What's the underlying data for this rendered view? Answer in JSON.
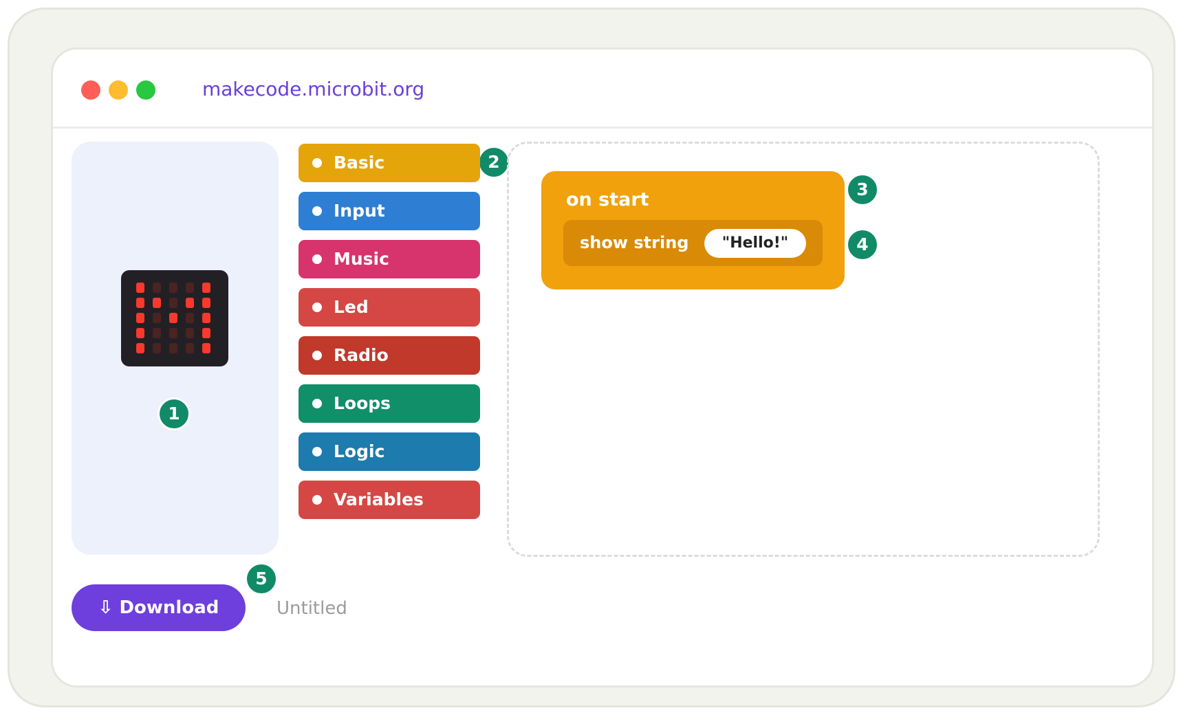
{
  "browser": {
    "url": "makecode.microbit.org",
    "traffic_lights": [
      "#ff5f57",
      "#febc2e",
      "#28c840"
    ],
    "url_color": "#6a3fd9"
  },
  "simulator": {
    "grid": [
      [
        1,
        0,
        0,
        0,
        1
      ],
      [
        1,
        1,
        0,
        1,
        1
      ],
      [
        1,
        0,
        1,
        0,
        1
      ],
      [
        1,
        0,
        0,
        0,
        1
      ],
      [
        1,
        0,
        0,
        0,
        1
      ]
    ],
    "led_on_color": "#f8392c",
    "led_off_color": "#4a2323"
  },
  "toolbox": {
    "categories": [
      {
        "label": "Basic",
        "color": "#e4a50a"
      },
      {
        "label": "Input",
        "color": "#2e7fd4"
      },
      {
        "label": "Music",
        "color": "#d7336c"
      },
      {
        "label": "Led",
        "color": "#d54744"
      },
      {
        "label": "Radio",
        "color": "#c0392b"
      },
      {
        "label": "Loops",
        "color": "#118f68"
      },
      {
        "label": "Logic",
        "color": "#1d7bad"
      },
      {
        "label": "Variables",
        "color": "#d54744"
      }
    ]
  },
  "workspace": {
    "event_block": {
      "label": "on start",
      "color": "#f0a10c"
    },
    "statement": {
      "label": "show string",
      "value": "\"Hello!\"",
      "color": "#d98a07"
    }
  },
  "badges": {
    "labels": [
      "1",
      "2",
      "3",
      "4",
      "5"
    ],
    "color": "#118a68"
  },
  "footer": {
    "download_label": "⇩ Download",
    "download_color": "#6e3fdc",
    "project_name": "Untitled"
  }
}
